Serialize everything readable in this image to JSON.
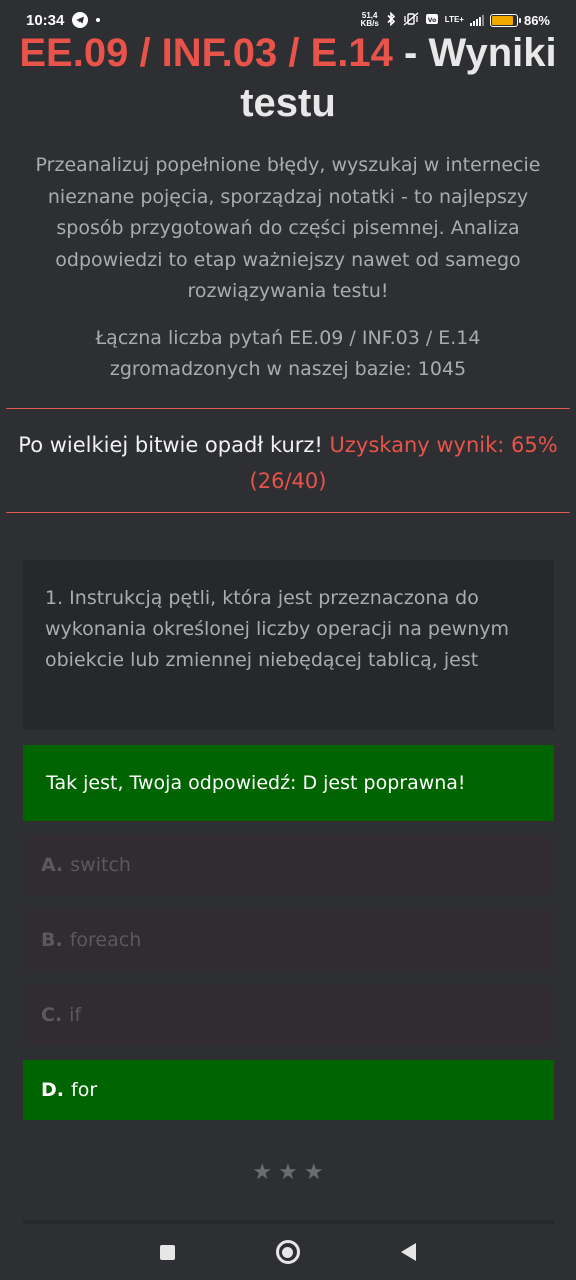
{
  "status_bar": {
    "time": "10:34",
    "net_speed_value": "51,4",
    "net_speed_unit": "KB/s",
    "lte_label": "LTE+",
    "battery_percent": "86%",
    "battery_level": 0.86,
    "battery_color": "#f2a900"
  },
  "header": {
    "title_code": "EE.09 / INF.03 / E.14",
    "title_rest": " - Wyniki testu",
    "intro": "Przeanalizuj popełnione błędy, wyszukaj w internecie nieznane pojęcia, sporządzaj notatki - to najlepszy sposób przygotowań do części pisemnej. Analiza odpowiedzi to etap ważniejszy nawet od samego rozwiązywania testu!",
    "count": "Łączna liczba pytań EE.09 / INF.03 / E.14 zgromadzonych w naszej bazie: 1045"
  },
  "result": {
    "lead": "Po wielkiej bitwie opadł kurz! ",
    "score": "Uzyskany wynik: 65% (26/40)"
  },
  "question": {
    "text": "1. Instrukcją pętli, która jest przeznaczona do wykonania określonej liczby operacji na pewnym obiekcie lub zmiennej niebędącej tablicą, jest",
    "feedback": "Tak jest, Twoja odpowiedź: D jest poprawna!",
    "answers": [
      {
        "letter": "A.",
        "text": "switch",
        "correct": false
      },
      {
        "letter": "B.",
        "text": "foreach",
        "correct": false
      },
      {
        "letter": "C.",
        "text": "if",
        "correct": false
      },
      {
        "letter": "D.",
        "text": "for",
        "correct": true
      }
    ]
  },
  "separator": {
    "stars": [
      "★",
      "★",
      "★"
    ]
  },
  "colors": {
    "accent_red": "#e8534a",
    "correct_green": "#006400",
    "background": "#2d2f33"
  }
}
